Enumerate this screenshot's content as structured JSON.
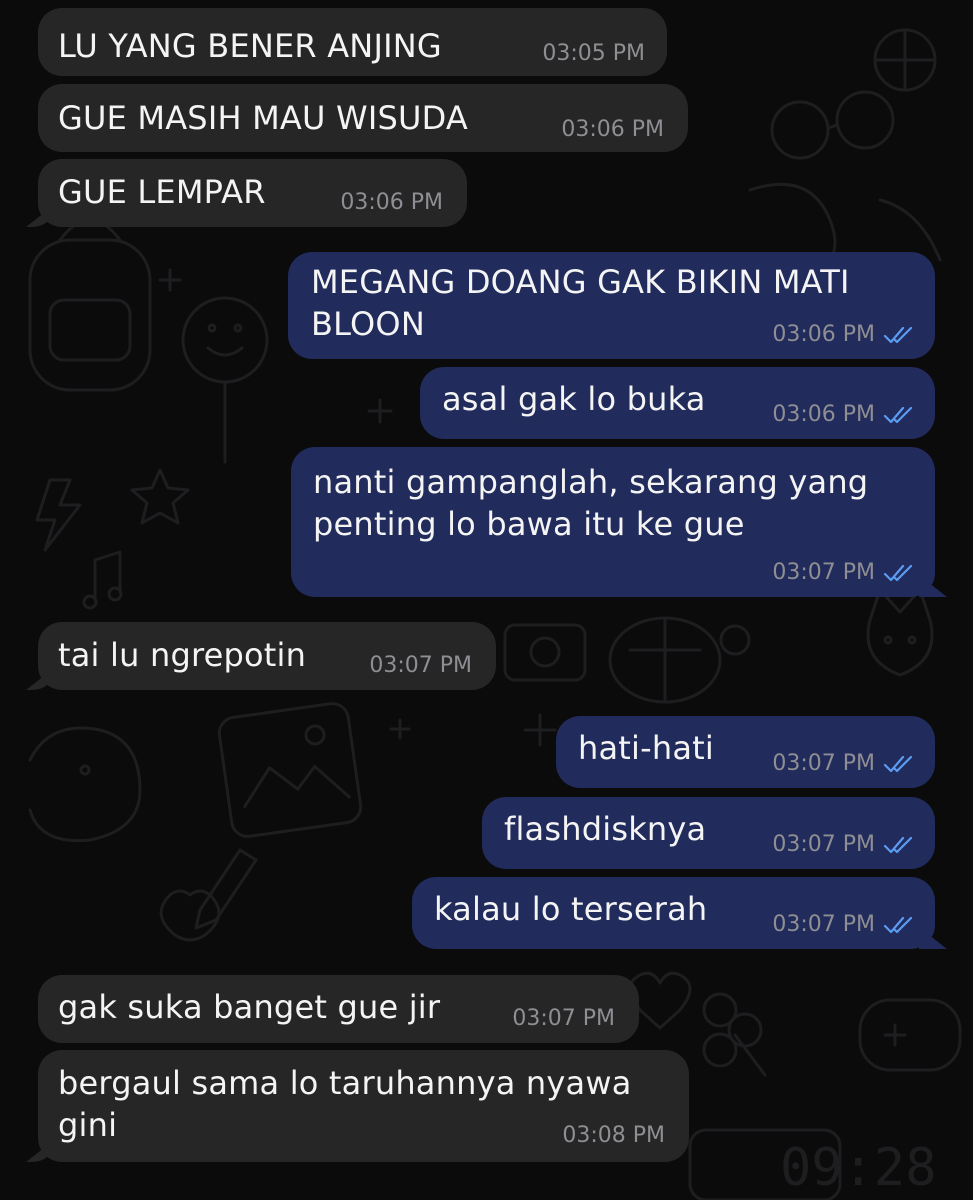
{
  "theme": {
    "incoming_bubble": "#262627",
    "outgoing_bubble": "#212b5c",
    "read_tick_color": "#5b9cf2",
    "time_color": "#8e8e93",
    "wallpaper_doodle_color": "#1d1d1f",
    "wallpaper_doodle_text": "09:28"
  },
  "messages": [
    {
      "direction": "incoming",
      "text": "LU YANG BENER ANJING",
      "time": "03:05 PM"
    },
    {
      "direction": "incoming",
      "text": "GUE MASIH MAU WISUDA",
      "time": "03:06 PM"
    },
    {
      "direction": "incoming",
      "text": "GUE LEMPAR",
      "time": "03:06 PM"
    },
    {
      "direction": "outgoing",
      "text": "MEGANG DOANG GAK BIKIN MATI\nBLOON",
      "time": "03:06 PM",
      "status": "read"
    },
    {
      "direction": "outgoing",
      "text": "asal gak lo buka",
      "time": "03:06 PM",
      "status": "read"
    },
    {
      "direction": "outgoing",
      "text": "nanti gampanglah, sekarang yang\npenting lo bawa itu ke gue",
      "time": "03:07 PM",
      "status": "read"
    },
    {
      "direction": "incoming",
      "text": "tai lu ngrepotin",
      "time": "03:07 PM"
    },
    {
      "direction": "outgoing",
      "text": "hati-hati",
      "time": "03:07 PM",
      "status": "read"
    },
    {
      "direction": "outgoing",
      "text": "flashdisknya",
      "time": "03:07 PM",
      "status": "read"
    },
    {
      "direction": "outgoing",
      "text": "kalau lo terserah",
      "time": "03:07 PM",
      "status": "read"
    },
    {
      "direction": "incoming",
      "text": "gak suka banget gue jir",
      "time": "03:07 PM"
    },
    {
      "direction": "incoming",
      "text": "bergaul sama lo taruhannya nyawa\ngini",
      "time": "03:08 PM"
    }
  ]
}
